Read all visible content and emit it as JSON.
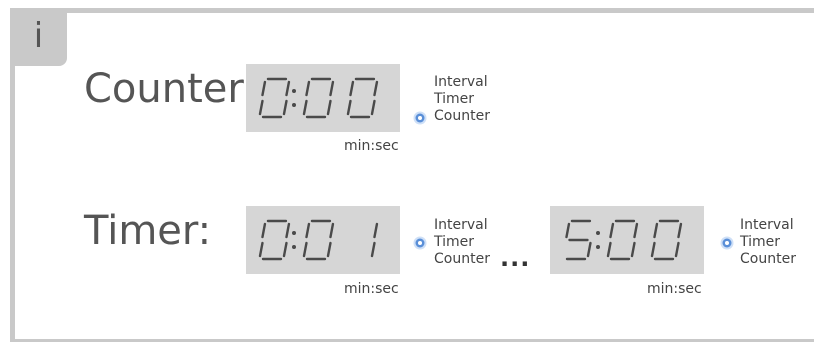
{
  "info_badge": "i",
  "counter": {
    "label": "Counter:",
    "display": "0:00",
    "unit": "min:sec",
    "modes": [
      "Interval",
      "Timer",
      "Counter"
    ],
    "active_mode": "Counter"
  },
  "timer": {
    "label": "Timer:",
    "start": {
      "display": "0:01",
      "unit": "min:sec",
      "modes": [
        "Interval",
        "Timer",
        "Counter"
      ],
      "active_mode": "Timer"
    },
    "ellipsis": "...",
    "end": {
      "display": "5:00",
      "unit": "min:sec",
      "modes": [
        "Interval",
        "Timer",
        "Counter"
      ],
      "active_mode": "Timer"
    }
  },
  "colors": {
    "frame": "#c9c9c9",
    "lcd_background": "#d6d6d6",
    "segment": "#4a4a4a",
    "indicator": "#5a8fd8"
  }
}
